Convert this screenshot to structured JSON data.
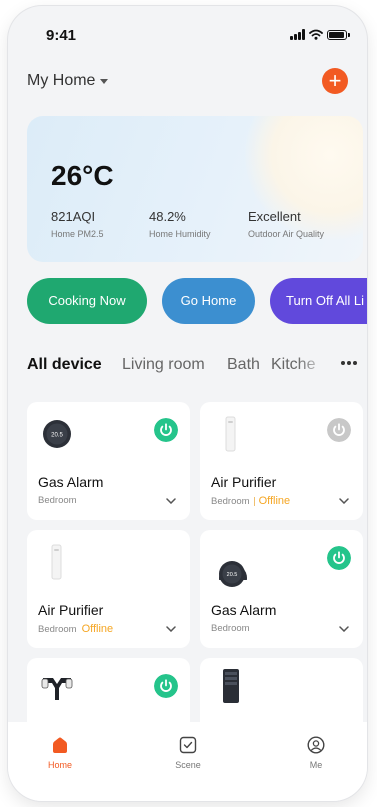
{
  "status_bar": {
    "time": "9:41"
  },
  "header": {
    "home_name": "My Home",
    "add_symbol": "+"
  },
  "weather": {
    "temperature": "26°C",
    "stats": [
      {
        "value": "821AQI",
        "label": "Home PM2.5"
      },
      {
        "value": "48.2%",
        "label": "Home Humidity"
      },
      {
        "value": "Excellent",
        "label": "Outdoor Air Quality"
      }
    ]
  },
  "scenes": [
    {
      "label": "Cooking Now",
      "color": "#1fa870"
    },
    {
      "label": "Go Home",
      "color": "#3c8fd0"
    },
    {
      "label": "Turn Off All Li",
      "color": "#6149dc"
    }
  ],
  "room_tabs": [
    "All device",
    "Living room",
    "Bath",
    "Kitche"
  ],
  "devices": [
    {
      "name": "Gas Alarm",
      "room": "Bedroom",
      "offline": "",
      "icon": "thermostat-icon",
      "display": "20.5",
      "power": "on"
    },
    {
      "name": "Air Purifier",
      "room": "Bedroom",
      "offline": "Offline",
      "icon": "air-purifier-icon",
      "power": "off"
    },
    {
      "name": "Air Purifier",
      "room": "Bedroom",
      "offline": "Offline",
      "icon": "air-purifier-icon",
      "power": "none"
    },
    {
      "name": "Gas Alarm",
      "room": "Bedroom",
      "offline": "",
      "icon": "thermostat-icon",
      "display": "20.5",
      "power": "on"
    },
    {
      "name": "",
      "room": "",
      "offline": "",
      "icon": "security-camera-icon",
      "power": "on"
    },
    {
      "name": "",
      "room": "",
      "offline": "",
      "icon": "control-panel-icon",
      "power": "none"
    }
  ],
  "tab_bar": [
    {
      "label": "Home",
      "icon": "home-icon",
      "active": true
    },
    {
      "label": "Scene",
      "icon": "scene-icon",
      "active": false
    },
    {
      "label": "Me",
      "icon": "profile-icon",
      "active": false
    }
  ],
  "colors": {
    "accent": "#f25a22",
    "power_on": "#25c48b",
    "power_off": "#c8c8c8",
    "offline": "#f5a623"
  }
}
